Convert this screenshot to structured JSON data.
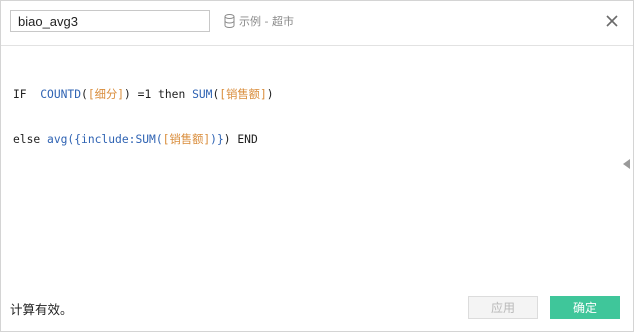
{
  "header": {
    "calc_name": "biao_avg3",
    "datasource_label": "示例 - 超市",
    "datasource_icon": "database-icon",
    "close_icon": "close-icon"
  },
  "formula": {
    "line1": [
      {
        "t": "IF  ",
        "c": "kw"
      },
      {
        "t": "COUNTD",
        "c": "fn"
      },
      {
        "t": "(",
        "c": "kw"
      },
      {
        "t": "[细分]",
        "c": "fld"
      },
      {
        "t": ") =1 then ",
        "c": "kw"
      },
      {
        "t": "SUM",
        "c": "fn"
      },
      {
        "t": "(",
        "c": "kw"
      },
      {
        "t": "[销售额]",
        "c": "fld"
      },
      {
        "t": ")",
        "c": "kw"
      }
    ],
    "line2": [
      {
        "t": "else ",
        "c": "kw"
      },
      {
        "t": "avg",
        "c": "fn"
      },
      {
        "t": "({",
        "c": "pn"
      },
      {
        "t": "include:",
        "c": "pn"
      },
      {
        "t": "SUM",
        "c": "fn"
      },
      {
        "t": "(",
        "c": "pn"
      },
      {
        "t": "[销售额]",
        "c": "fld"
      },
      {
        "t": ")}",
        "c": "pn"
      },
      {
        "t": ") END",
        "c": "kw"
      }
    ]
  },
  "footer": {
    "status_text": "计算有效。",
    "apply_label": "应用",
    "ok_label": "确定"
  },
  "colors": {
    "accent": "#3fc69a",
    "function": "#2f63b3",
    "field": "#d98c3a"
  }
}
